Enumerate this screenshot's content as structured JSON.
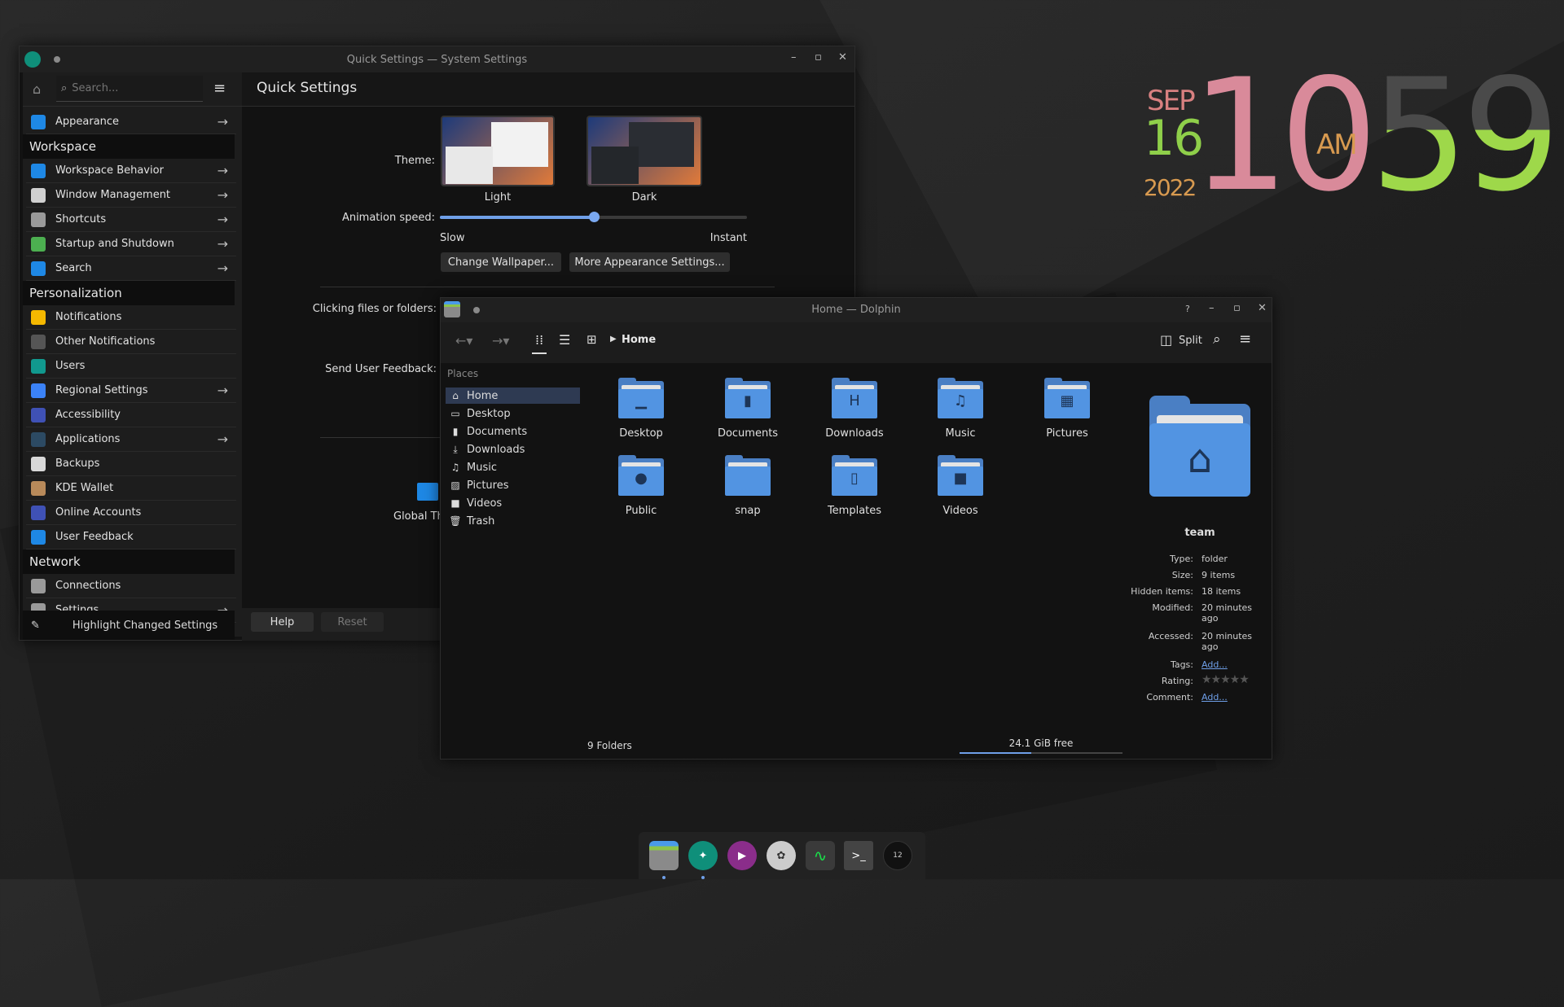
{
  "desktop_clock": {
    "month": "SEP",
    "day": "16",
    "year": "2022",
    "hour": "10",
    "ampm": "AM",
    "minute": "59",
    "colors": {
      "hour": "#d98a9a",
      "minute": "#9ed84a",
      "month": "#d88080",
      "year": "#d89a50"
    }
  },
  "settings": {
    "window_title": "Quick Settings — System Settings",
    "search_placeholder": "Search...",
    "page_title": "Quick Settings",
    "sidebar": [
      {
        "type": "item",
        "label": "Appearance",
        "arrow": true,
        "icon": "appearance-icon",
        "color": "#1e88e5"
      },
      {
        "type": "header",
        "label": "Workspace"
      },
      {
        "type": "item",
        "label": "Workspace Behavior",
        "arrow": true,
        "icon": "workspace-behavior-icon",
        "color": "#1e88e5"
      },
      {
        "type": "item",
        "label": "Window Management",
        "arrow": true,
        "icon": "window-management-icon",
        "color": "#d0d0d0"
      },
      {
        "type": "item",
        "label": "Shortcuts",
        "arrow": true,
        "icon": "keyboard-icon",
        "color": "#9a9a9a"
      },
      {
        "type": "item",
        "label": "Startup and Shutdown",
        "arrow": true,
        "icon": "rocket-icon",
        "color": "#4caf50"
      },
      {
        "type": "item",
        "label": "Search",
        "arrow": true,
        "icon": "search-icon",
        "color": "#1e88e5"
      },
      {
        "type": "header",
        "label": "Personalization"
      },
      {
        "type": "item",
        "label": "Notifications",
        "arrow": false,
        "icon": "bell-icon",
        "color": "#f5b800"
      },
      {
        "type": "item",
        "label": "Other Notifications",
        "arrow": false,
        "icon": "notification-icon",
        "color": "#555"
      },
      {
        "type": "item",
        "label": "Users",
        "arrow": false,
        "icon": "user-icon",
        "color": "#11998e"
      },
      {
        "type": "item",
        "label": "Regional Settings",
        "arrow": true,
        "icon": "language-icon",
        "color": "#3b82f6"
      },
      {
        "type": "item",
        "label": "Accessibility",
        "arrow": false,
        "icon": "accessibility-icon",
        "color": "#3f51b5"
      },
      {
        "type": "item",
        "label": "Applications",
        "arrow": true,
        "icon": "applications-icon",
        "color": "#2c4a63"
      },
      {
        "type": "item",
        "label": "Backups",
        "arrow": false,
        "icon": "backup-icon",
        "color": "#d8d8d8"
      },
      {
        "type": "item",
        "label": "KDE Wallet",
        "arrow": false,
        "icon": "wallet-icon",
        "color": "#b88a5a"
      },
      {
        "type": "item",
        "label": "Online Accounts",
        "arrow": false,
        "icon": "online-accounts-icon",
        "color": "#3f51b5"
      },
      {
        "type": "item",
        "label": "User Feedback",
        "arrow": false,
        "icon": "feedback-icon",
        "color": "#1e88e5"
      },
      {
        "type": "header",
        "label": "Network"
      },
      {
        "type": "item",
        "label": "Connections",
        "arrow": false,
        "icon": "network-icon",
        "color": "#9a9a9a"
      },
      {
        "type": "item",
        "label": "Settings",
        "arrow": true,
        "icon": "network-settings-icon",
        "color": "#9a9a9a"
      }
    ],
    "highlight_changed": "Highlight Changed Settings",
    "theme_label": "Theme:",
    "themes": [
      {
        "label": "Light"
      },
      {
        "label": "Dark"
      }
    ],
    "animation_label": "Animation speed:",
    "animation_value_pct": 50,
    "slow": "Slow",
    "instant": "Instant",
    "change_wallpaper": "Change Wallpaper...",
    "more_appearance": "More Appearance Settings...",
    "clicking_label": "Clicking files or folders:",
    "feedback_label": "Send User Feedback:",
    "global_theme": "Global Th",
    "help": "Help",
    "reset": "Reset"
  },
  "dolphin": {
    "window_title": "Home — Dolphin",
    "breadcrumb": "Home",
    "split": "Split",
    "places_title": "Places",
    "places": [
      {
        "label": "Home",
        "glyph": "⌂",
        "selected": true
      },
      {
        "label": "Desktop",
        "glyph": "▭"
      },
      {
        "label": "Documents",
        "glyph": "▮"
      },
      {
        "label": "Downloads",
        "glyph": "⤓"
      },
      {
        "label": "Music",
        "glyph": "♫"
      },
      {
        "label": "Pictures",
        "glyph": "▨"
      },
      {
        "label": "Videos",
        "glyph": "■"
      },
      {
        "label": "Trash",
        "glyph": "🗑"
      }
    ],
    "folders": [
      {
        "label": "Desktop",
        "glyph": "▁"
      },
      {
        "label": "Documents",
        "glyph": "▮"
      },
      {
        "label": "Downloads",
        "glyph": "H"
      },
      {
        "label": "Music",
        "glyph": "♫"
      },
      {
        "label": "Pictures",
        "glyph": "▦"
      },
      {
        "label": "Public",
        "glyph": "●"
      },
      {
        "label": "snap",
        "glyph": ""
      },
      {
        "label": "Templates",
        "glyph": "▯"
      },
      {
        "label": "Videos",
        "glyph": "■"
      }
    ],
    "info": {
      "name": "team",
      "rows": [
        {
          "k": "Type:",
          "v": "folder"
        },
        {
          "k": "Size:",
          "v": "9 items"
        },
        {
          "k": "Hidden items:",
          "v": "18 items"
        },
        {
          "k": "Modified:",
          "v": "20 minutes ago"
        },
        {
          "k": "Accessed:",
          "v": "20 minutes ago"
        },
        {
          "k": "Tags:",
          "v": "Add..."
        },
        {
          "k": "Rating:",
          "v": "★★★★★"
        },
        {
          "k": "Comment:",
          "v": "Add..."
        }
      ],
      "rating": 0
    },
    "status_left": "9 Folders",
    "free_space": "24.1 GiB free",
    "used_fraction": 0.44
  },
  "dock": [
    {
      "name": "dolphin-icon"
    },
    {
      "name": "system-settings-icon"
    },
    {
      "name": "media-player-icon"
    },
    {
      "name": "video-editor-icon"
    },
    {
      "name": "system-monitor-icon"
    },
    {
      "name": "terminal-icon"
    },
    {
      "name": "clock-icon"
    }
  ]
}
